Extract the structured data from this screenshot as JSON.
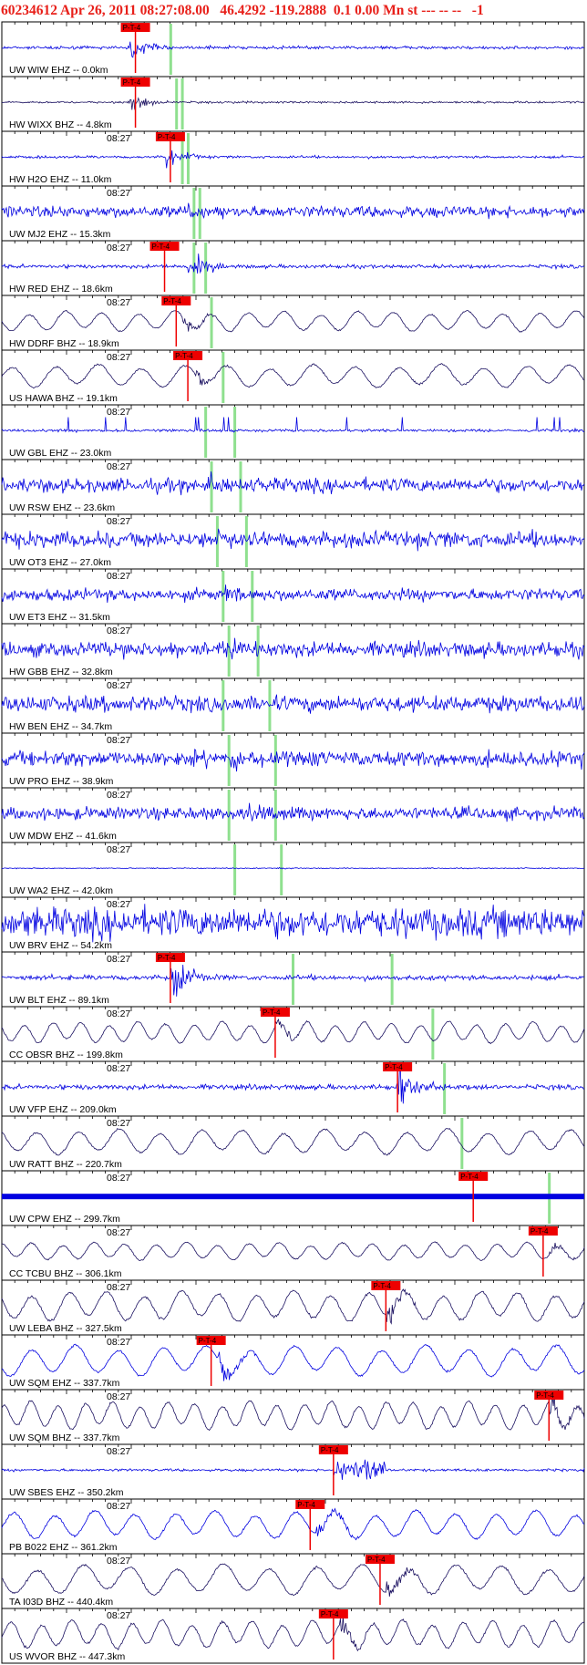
{
  "header": {
    "text": "60234612 Apr 26, 2011 08:27:08.00   46.4292 -119.2888  0.1 0.00 Mn st --- -- --   -1"
  },
  "colors": {
    "header_red": "#e8201a",
    "trace_blue": "#0000e0",
    "trace_navy": "#1a1060",
    "pick_red": "#ee0000",
    "green_marker": "#8fe08f",
    "frame": "#000000"
  },
  "pick_label": "P-T-4",
  "tick_label_time": "08:27",
  "traces": [
    {
      "label": "UW WIW EHZ -- 0.0km",
      "color": "blue",
      "amp": 0.18,
      "style": "quake",
      "pick": 0.22,
      "event": 0.22,
      "green": [
        0.29
      ],
      "time_label": false
    },
    {
      "label": "HW WIXX BHZ -- 4.8km",
      "color": "navy",
      "amp": 0.12,
      "style": "quake",
      "pick": 0.22,
      "event": 0.22,
      "green": [
        0.3,
        0.31
      ],
      "time_label": false
    },
    {
      "label": "HW H2O EHZ -- 11.0km",
      "color": "blue",
      "amp": 0.15,
      "style": "quake",
      "pick": 0.28,
      "event": 0.28,
      "green": [
        0.31,
        0.32
      ],
      "time_label": true
    },
    {
      "label": "UW MJ2 EHZ -- 15.3km",
      "color": "blue",
      "amp": 0.35,
      "style": "noise",
      "pick": null,
      "event": 0.32,
      "green": [
        0.33,
        0.34
      ],
      "time_label": true
    },
    {
      "label": "HW RED EHZ -- 18.6km",
      "color": "blue",
      "amp": 0.22,
      "style": "quake",
      "pick": 0.27,
      "event": 0.32,
      "green": [
        0.33,
        0.35
      ],
      "time_label": true
    },
    {
      "label": "HW DDRF BHZ -- 18.9km",
      "color": "navy",
      "amp": 0.4,
      "style": "wave",
      "pick": 0.29,
      "event": 0.31,
      "green": [
        0.36
      ],
      "time_label": true
    },
    {
      "label": "US HAWA BHZ -- 19.1km",
      "color": "navy",
      "amp": 0.45,
      "style": "wave",
      "pick": 0.31,
      "event": 0.33,
      "green": [
        0.38
      ],
      "time_label": true
    },
    {
      "label": "UW GBL EHZ -- 23.0km",
      "color": "blue",
      "amp": 0.14,
      "style": "spiky",
      "pick": null,
      "event": null,
      "green": [
        0.35,
        0.4
      ],
      "time_label": true
    },
    {
      "label": "UW RSW EHZ -- 23.6km",
      "color": "blue",
      "amp": 0.42,
      "style": "noise",
      "pick": null,
      "event": 0.35,
      "green": [
        0.36,
        0.41
      ],
      "time_label": true
    },
    {
      "label": "UW OT3 EHZ -- 27.0km",
      "color": "blue",
      "amp": 0.48,
      "style": "noise",
      "pick": null,
      "event": 0.37,
      "green": [
        0.37,
        0.42
      ],
      "time_label": true
    },
    {
      "label": "UW ET3 EHZ -- 31.5km",
      "color": "blue",
      "amp": 0.36,
      "style": "noise",
      "pick": null,
      "event": 0.38,
      "green": [
        0.38,
        0.43
      ],
      "time_label": true
    },
    {
      "label": "HW GBB EHZ -- 32.8km",
      "color": "blue",
      "amp": 0.45,
      "style": "noise",
      "pick": null,
      "event": 0.39,
      "green": [
        0.39,
        0.44
      ],
      "time_label": true
    },
    {
      "label": "HW BEN EHZ -- 34.7km",
      "color": "blue",
      "amp": 0.48,
      "style": "noise",
      "pick": null,
      "event": null,
      "green": [
        0.38,
        0.46
      ],
      "time_label": true
    },
    {
      "label": "UW PRO EHZ -- 38.9km",
      "color": "blue",
      "amp": 0.46,
      "style": "noise",
      "pick": null,
      "event": 0.4,
      "green": [
        0.39,
        0.47
      ],
      "time_label": true
    },
    {
      "label": "UW MDW EHZ -- 41.6km",
      "color": "blue",
      "amp": 0.38,
      "style": "noise",
      "pick": null,
      "event": 0.42,
      "green": [
        0.39,
        0.47
      ],
      "time_label": true
    },
    {
      "label": "UW WA2 EHZ -- 42.0km",
      "color": "blue",
      "amp": 0.05,
      "style": "flat",
      "pick": null,
      "event": 0.47,
      "green": [
        0.4,
        0.48
      ],
      "time_label": true
    },
    {
      "label": "UW BRV EHZ -- 54.2km",
      "color": "blue",
      "amp": 0.9,
      "style": "noise",
      "pick": null,
      "event": null,
      "green": [],
      "time_label": true
    },
    {
      "label": "UW BLT EHZ -- 89.1km",
      "color": "blue",
      "amp": 0.3,
      "style": "quake",
      "pick": 0.28,
      "event": 0.29,
      "green": [
        0.5,
        0.67
      ],
      "time_label": true
    },
    {
      "label": "CC OBSR BHZ -- 199.8km",
      "color": "navy",
      "amp": 0.42,
      "style": "wave",
      "pick": 0.46,
      "event": 0.47,
      "green": [
        0.74
      ],
      "time_label": true
    },
    {
      "label": "UW VFP EHZ -- 209.0km",
      "color": "blue",
      "amp": 0.3,
      "style": "quake",
      "pick": 0.67,
      "event": 0.68,
      "green": [
        0.76
      ],
      "time_label": true
    },
    {
      "label": "UW RATT BHZ -- 220.7km",
      "color": "navy",
      "amp": 0.5,
      "style": "wave",
      "pick": null,
      "event": null,
      "green": [
        0.79
      ],
      "time_label": true
    },
    {
      "label": "UW CPW EHZ -- 299.7km",
      "color": "blue",
      "amp": 0.06,
      "style": "cpw",
      "pick": 0.8,
      "event": 0.81,
      "green": [
        0.94
      ],
      "time_label": true
    },
    {
      "label": "CC TCBU BHZ -- 306.1km",
      "color": "navy",
      "amp": 0.35,
      "style": "wave",
      "pick": 0.92,
      "event": 0.94,
      "green": [],
      "time_label": true
    },
    {
      "label": "UW LEBA BHZ -- 327.5km",
      "color": "navy",
      "amp": 0.6,
      "style": "wave",
      "pick": 0.65,
      "event": 0.66,
      "green": [],
      "time_label": true
    },
    {
      "label": "UW SQM EHZ -- 337.7km",
      "color": "blue",
      "amp": 0.6,
      "style": "wave",
      "pick": 0.35,
      "event": 0.37,
      "green": [],
      "time_label": true
    },
    {
      "label": "UW SQM BHZ -- 337.7km",
      "color": "navy",
      "amp": 0.55,
      "style": "wave",
      "pick": 0.93,
      "event": 0.94,
      "green": [],
      "time_label": true
    },
    {
      "label": "UW SBES EHZ -- 350.2km",
      "color": "blue",
      "amp": 0.1,
      "style": "sbes",
      "pick": 0.56,
      "event": 0.58,
      "green": [],
      "time_label": true
    },
    {
      "label": "PB B022 EHZ -- 361.2km",
      "color": "blue",
      "amp": 0.55,
      "style": "wave",
      "pick": 0.52,
      "event": 0.54,
      "green": [],
      "time_label": true
    },
    {
      "label": "TA I03D BHZ -- 440.4km",
      "color": "navy",
      "amp": 0.6,
      "style": "wave",
      "pick": 0.64,
      "event": 0.66,
      "green": [],
      "time_label": true
    },
    {
      "label": "US WVOR BHZ -- 447.3km",
      "color": "navy",
      "amp": 0.55,
      "style": "wave",
      "pick": 0.56,
      "event": 0.58,
      "green": [],
      "time_label": true
    }
  ]
}
